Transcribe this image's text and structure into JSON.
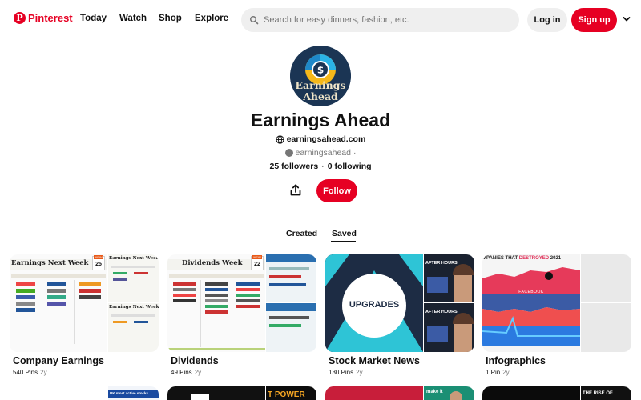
{
  "header": {
    "logo_text": "Pinterest",
    "logo_letter": "P",
    "nav": [
      "Today",
      "Watch",
      "Shop",
      "Explore"
    ],
    "search_placeholder": "Search for easy dinners, fashion, etc.",
    "login_label": "Log in",
    "signup_label": "Sign up",
    "brand_color": "#e60023"
  },
  "profile": {
    "name": "Earnings Ahead",
    "avatar_text_1": "Earnings",
    "avatar_text_2": "Ahead",
    "avatar_symbol": "$",
    "website": "earningsahead.com",
    "handle": "earningsahead",
    "handle_sep": "·",
    "followers": "25 followers",
    "sep": "·",
    "following": "0 following",
    "follow_label": "Follow"
  },
  "tabs": [
    {
      "label": "Created",
      "active": false
    },
    {
      "label": "Saved",
      "active": true
    }
  ],
  "boards": [
    {
      "title": "Company Earnings",
      "pins": "540 Pins",
      "age": "2y",
      "thumb_main": "Earnings Next Week",
      "thumb_side_1": "Earnings Next Week",
      "thumb_side_2": "Earnings Next Week",
      "date": "25",
      "badge": "NEW"
    },
    {
      "title": "Dividends",
      "pins": "49 Pins",
      "age": "2y",
      "thumb_main": "Dividends Week",
      "date": "22",
      "badge": "NEW"
    },
    {
      "title": "Stock Market News",
      "pins": "130 Pins",
      "age": "2y",
      "thumb_main": "UPGRADES",
      "thumb_side_1": "AFTER HOURS",
      "thumb_side_2": "AFTER HOURS"
    },
    {
      "title": "Infographics",
      "pins": "1 Pin",
      "age": "2y",
      "thumb_main": "MPANIES THAT ",
      "thumb_main_accent": "DESTROYED",
      "thumb_main_year": " 2021",
      "thumb_label": "FACEBOOK"
    }
  ],
  "row2": {
    "b1_text": "UK most active stocks",
    "b2_text": "T POWER",
    "b3_text": "make it",
    "b4_text": "THE RISE OF"
  },
  "icons": [
    "pinterest-logo-icon",
    "search-icon",
    "chevron-down-icon",
    "globe-icon",
    "pinterest-small-icon",
    "share-icon"
  ]
}
